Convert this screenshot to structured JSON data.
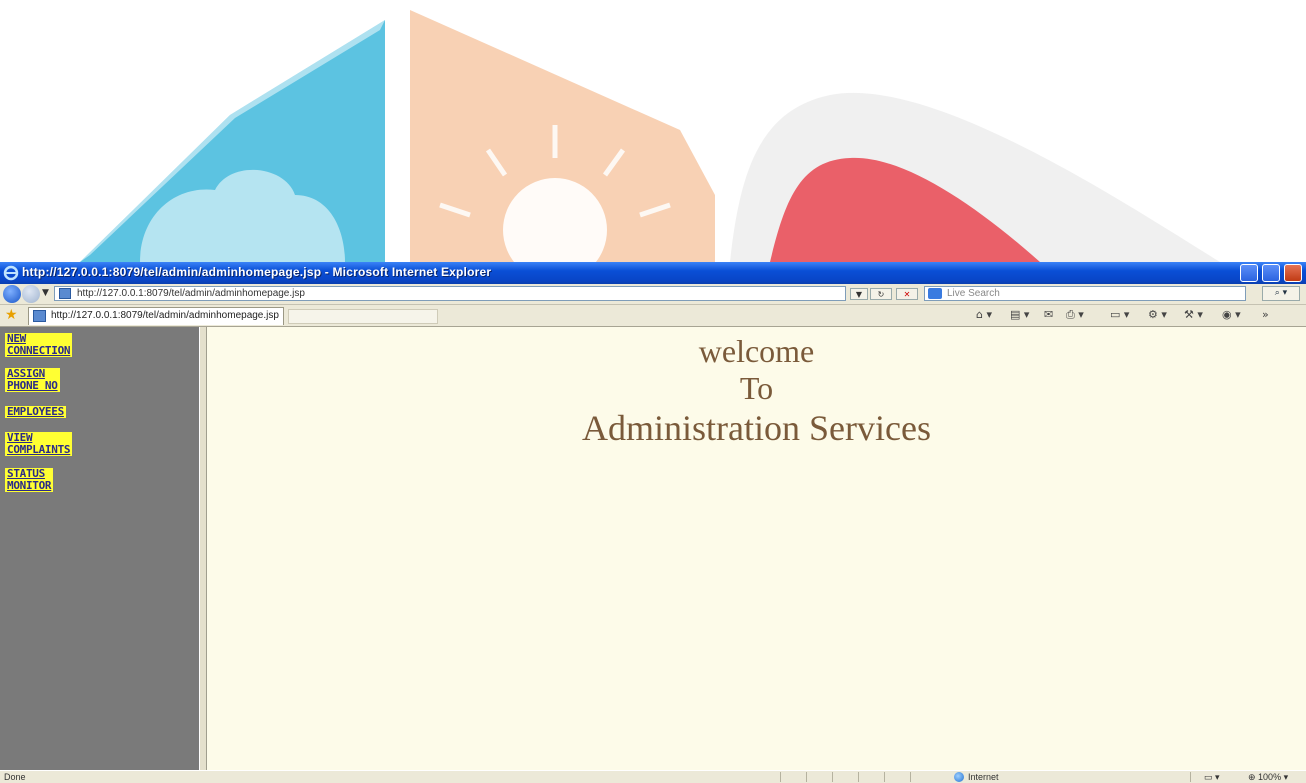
{
  "window": {
    "title": "http://127.0.0.1:8079/tel/admin/adminhomepage.jsp - Microsoft Internet Explorer"
  },
  "address_bar": {
    "url": "http://127.0.0.1:8079/tel/admin/adminhomepage.jsp",
    "search_placeholder": "Live Search"
  },
  "tab": {
    "label": "http://127.0.0.1:8079/tel/admin/adminhomepage.jsp"
  },
  "sidebar": {
    "items": [
      {
        "line1": "NEW",
        "line2": "CONNECTION"
      },
      {
        "line1": "ASSIGN",
        "line2": "PHONE NO"
      },
      {
        "line1": "EMPLOYEES",
        "line2": ""
      },
      {
        "line1": "VIEW",
        "line2": "COMPLAINTS"
      },
      {
        "line1": "STATUS",
        "line2": "MONITOR"
      }
    ]
  },
  "main": {
    "line1": "welcome",
    "line2": "To",
    "line3": "Administration Services"
  },
  "status_bar": {
    "status": "Done",
    "zone": "Internet",
    "zoom": "100%"
  },
  "colors": {
    "menu_highlight": "#ffff33",
    "sidebar_bg": "#7a7a7a",
    "main_bg": "#fdfbe9",
    "heading_text": "#7a5a3a",
    "titlebar": "#0a4fd6"
  }
}
